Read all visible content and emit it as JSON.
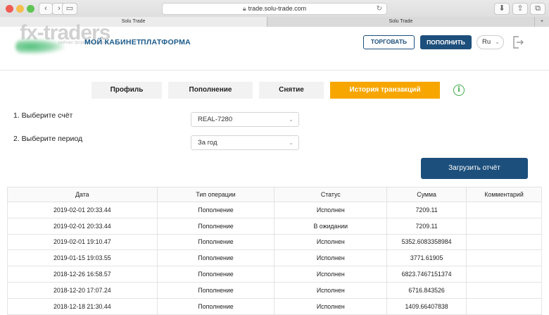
{
  "browser": {
    "url": "trade.solu-trade.com",
    "tabs": [
      "Solu Trade",
      "Solu Trade"
    ]
  },
  "watermark": {
    "brand": "fx-traders",
    "tagline": "рейтинг форекс брокеров"
  },
  "header": {
    "nav": [
      "МОЙ КАБИНЕТ",
      "ПЛАТФОРМА"
    ],
    "trade_button": "ТОРГОВАТЬ",
    "deposit_button": "ПОПОЛНИТЬ",
    "language": "Ru"
  },
  "tabs": [
    {
      "label": "Профиль",
      "active": false
    },
    {
      "label": "Пополнение",
      "active": false
    },
    {
      "label": "Снятие",
      "active": false
    },
    {
      "label": "История транзакций",
      "active": true
    }
  ],
  "form": {
    "account_label": "1. Выберите счёт",
    "account_value": "REAL-7280",
    "period_label": "2. Выберите период",
    "period_value": "За год",
    "report_button": "Загрузить отчёт"
  },
  "table": {
    "headers": [
      "Дата",
      "Тип операции",
      "Статус",
      "Сумма",
      "Комментарий"
    ],
    "rows": [
      [
        "2019-02-01 20:33.44",
        "Пополнение",
        "Исполнен",
        "7209.11",
        ""
      ],
      [
        "2019-02-01 20:33.44",
        "Пополнение",
        "В ожидании",
        "7209.11",
        ""
      ],
      [
        "2019-02-01 19:10.47",
        "Пополнение",
        "Исполнен",
        "5352.6083358984",
        ""
      ],
      [
        "2019-01-15 19:03.55",
        "Пополнение",
        "Исполнен",
        "3771.61905",
        ""
      ],
      [
        "2018-12-26 16:58.57",
        "Пополнение",
        "Исполнен",
        "6823.7467151374",
        ""
      ],
      [
        "2018-12-20 17:07.24",
        "Пополнение",
        "Исполнен",
        "6716.843526",
        ""
      ],
      [
        "2018-12-18 21:30.44",
        "Пополнение",
        "Исполнен",
        "1409.66407838",
        ""
      ]
    ]
  },
  "colors": {
    "primary": "#1d4f7c",
    "accent": "#f7a600",
    "info": "#3fae49"
  }
}
